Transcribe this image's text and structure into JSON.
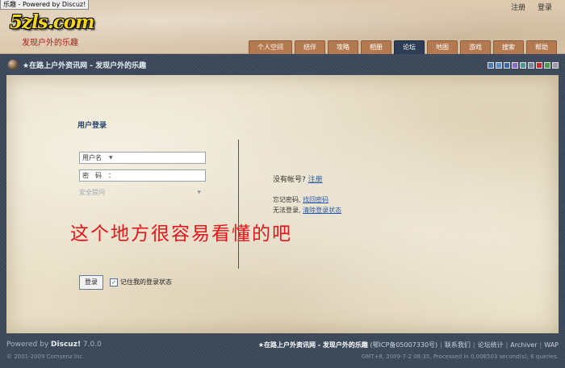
{
  "titlebar": {
    "text": "乐趣 - Powered by Discuz!"
  },
  "header": {
    "logo": "5zls.com",
    "tagline": "发现户外的乐趣",
    "top_links": [
      "注册",
      "登录"
    ],
    "nav": [
      "个人空间",
      "结伴",
      "攻略",
      "相册",
      "论坛",
      "地图",
      "游戏",
      "搜索",
      "帮助"
    ],
    "active_nav": "论坛"
  },
  "breadcrumb": {
    "text": "★在路上户外资讯网 - 发现户外的乐趣"
  },
  "swatches": [
    "#4a7ab8",
    "#5a8ac8",
    "#3a6aa8",
    "#8a6ac8",
    "#4a9a9a",
    "#7a8a9a",
    "#c82a2a",
    "#4a9a4a",
    "#9a9aaa"
  ],
  "login": {
    "title": "用户登录",
    "username_label": "用户名",
    "password_label": "密　码　：",
    "security_label": "安全提问",
    "login_button": "登录",
    "remember_label": "记住我的登录状态",
    "no_account_text": "没有帐号?",
    "register_link": "注册",
    "forgot_text": "忘记密码,",
    "forgot_link": "找回密码",
    "cannot_login_text": "无法登录,",
    "clear_state_link": "清除登录状态"
  },
  "annotation": "这个地方很容易看懂的吧",
  "footer": {
    "powered_prefix": "Powered by",
    "powered_product": "Discuz!",
    "powered_version": "7.0.0",
    "copyright": "© 2001-2009 Comsenz Inc.",
    "site_name": "★在路上户外资讯网 - 发现户外的乐趣",
    "icp": "(鄂ICP备05007330号)",
    "links": [
      "联系我们",
      "论坛统计",
      "Archiver",
      "WAP"
    ],
    "stats": "GMT+8, 2009-7-2 08:35, Processed in 0.008503 second(s), 6 queries."
  }
}
